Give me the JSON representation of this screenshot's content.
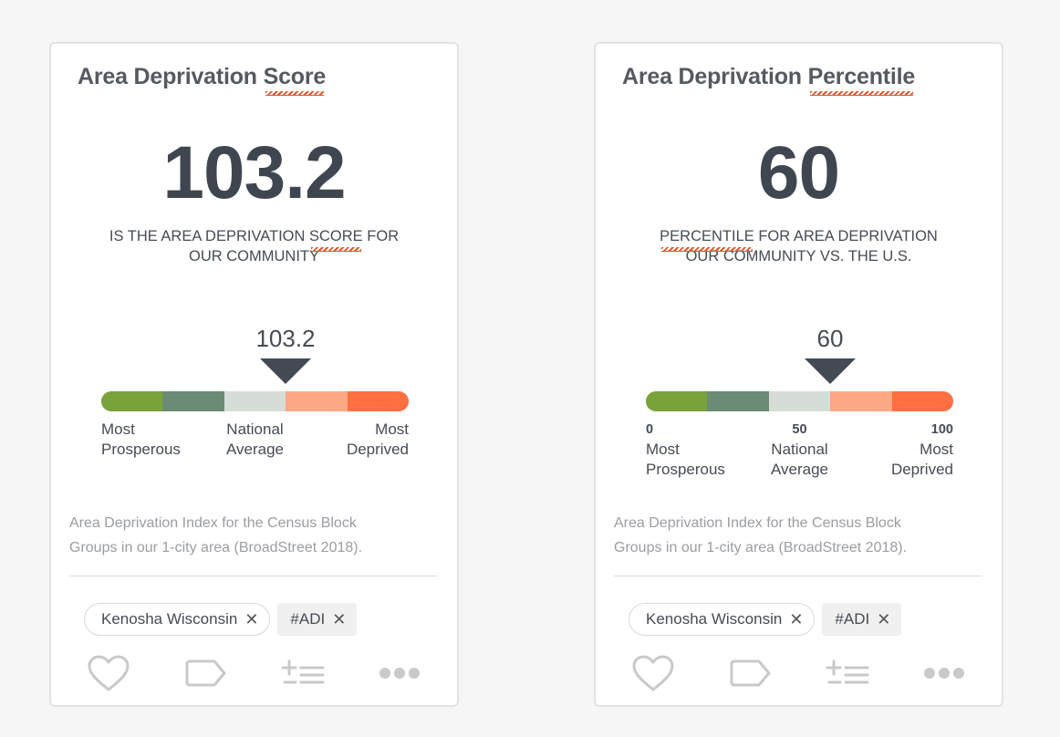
{
  "cards": [
    {
      "title_main": "Area Deprivation ",
      "title_emph": "Score",
      "value": "103.2",
      "caption_line1_a": "IS THE AREA DEPRIVATION ",
      "caption_line1_emph": "SCORE",
      "caption_line1_b": " FOR",
      "caption_line2": "OUR COMMUNITY",
      "marker_label": "103.2",
      "marker_position_fraction": 0.6,
      "scale": {
        "left_num": "",
        "mid_num": "",
        "right_num": "",
        "left_label_1": "Most",
        "left_label_2": "Prosperous",
        "mid_label_1": "National",
        "mid_label_2": "Average",
        "right_label_1": "Most",
        "right_label_2": "Deprived"
      },
      "source_line1": "Area Deprivation Index for the Census Block",
      "source_line2": "Groups in our 1-city area (BroadStreet 2018).",
      "tags": {
        "location": "Kenosha Wisconsin",
        "hashtag": "#ADI",
        "remove_glyph": "✕"
      }
    },
    {
      "title_main": "Area Deprivation ",
      "title_emph": "Percentile",
      "value": "60",
      "caption_line1_a": "",
      "caption_line1_emph": "PERCENTILE",
      "caption_line1_b": " FOR AREA DEPRIVATION",
      "caption_line2": "OUR COMMUNITY vs. THE U.S.",
      "marker_label": "60",
      "marker_position_fraction": 0.6,
      "scale": {
        "left_num": "0",
        "mid_num": "50",
        "right_num": "100",
        "left_label_1": "Most",
        "left_label_2": "Prosperous",
        "mid_label_1": "National",
        "mid_label_2": "Average",
        "right_label_1": "Most",
        "right_label_2": "Deprived"
      },
      "source_line1": "Area Deprivation Index for the Census Block",
      "source_line2": "Groups in our 1-city area (BroadStreet 2018).",
      "tags": {
        "location": "Kenosha Wisconsin",
        "hashtag": "#ADI",
        "remove_glyph": "✕"
      }
    }
  ],
  "scale_colors": [
    "#7aa23a",
    "#6a8c74",
    "#d6ddd7",
    "#fda785",
    "#fe6f41"
  ],
  "accent_underline": "#e2582c",
  "icons": [
    "heart-icon",
    "tag-icon",
    "add-to-list-icon",
    "more-icon"
  ]
}
